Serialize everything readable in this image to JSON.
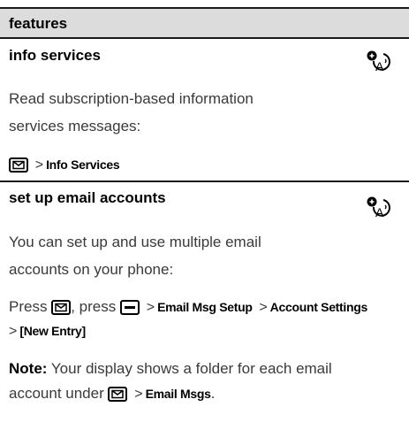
{
  "header": {
    "title": "features"
  },
  "sections": [
    {
      "title": "info services",
      "icon": "network-feature-icon",
      "body_lines": [
        "Read subscription-based information",
        "services messages:"
      ],
      "path": {
        "key_icon": "message-key-icon",
        "sep": ">",
        "item": "Info Services"
      }
    },
    {
      "title": "set up email accounts",
      "icon": "network-feature-icon",
      "body_lines": [
        "You can set up and use multiple email",
        "accounts on your phone:"
      ],
      "press_line": {
        "press1": "Press",
        "comma": ",",
        "press2": "press",
        "key1": "message-key-icon",
        "key2": "menu-key-icon",
        "sep": ">",
        "item1": "Email Msg Setup",
        "item2": "Account Settings",
        "item3": "[New Entry]"
      },
      "note": {
        "label": "Note:",
        "text1": "Your display shows a folder for each email",
        "text2": "account under",
        "sep": ">",
        "item": "Email Msgs",
        "period": "."
      }
    }
  ]
}
